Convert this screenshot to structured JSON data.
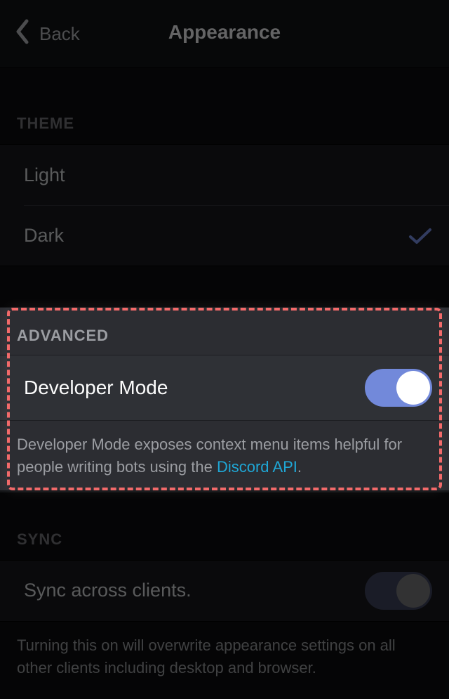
{
  "header": {
    "back_label": "Back",
    "title": "Appearance"
  },
  "theme": {
    "section": "THEME",
    "options": {
      "light": "Light",
      "dark": "Dark"
    },
    "selected": "dark"
  },
  "advanced": {
    "section": "ADVANCED",
    "dev_mode_label": "Developer Mode",
    "dev_mode_on": true,
    "desc_pre": "Developer Mode exposes context menu items helpful for people writing bots using the ",
    "desc_link": "Discord API",
    "desc_post": "."
  },
  "sync": {
    "section": "SYNC",
    "label": "Sync across clients.",
    "on": false,
    "desc": "Turning this on will overwrite appearance settings on all other clients including desktop and browser."
  }
}
